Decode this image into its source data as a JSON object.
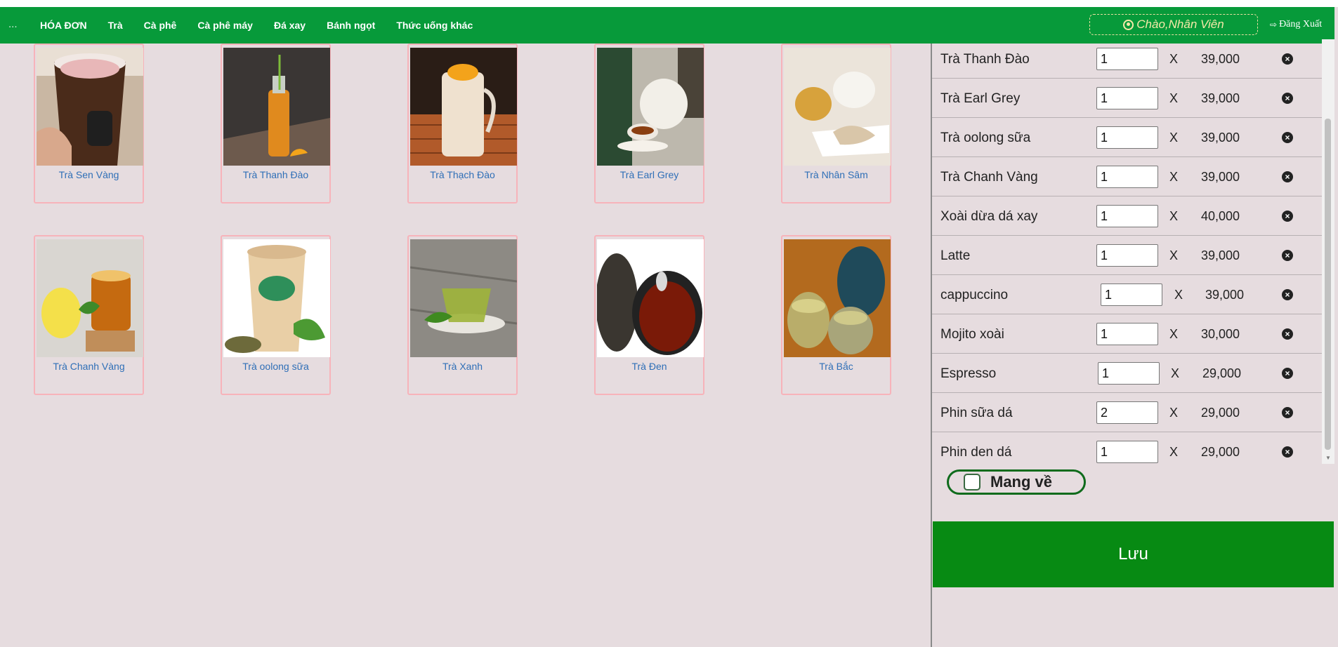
{
  "nav": {
    "dots": "...",
    "items": [
      "HÓA ĐƠN",
      "Trà",
      "Cà phê",
      "Cà phê máy",
      "Đá xay",
      "Bánh ngọt",
      "Thức uống khác"
    ],
    "greeting": "Chào,Nhân Viên",
    "logout": "Đăng Xuất"
  },
  "products": [
    {
      "name": "Trà Sen Vàng",
      "icon": "milk-tea-cup-photo"
    },
    {
      "name": "Trà Thanh Đào",
      "icon": "bottle-tea-photo"
    },
    {
      "name": "Trà Thạch Đào",
      "icon": "jar-tea-photo"
    },
    {
      "name": "Trà Earl Grey",
      "icon": "teapot-photo"
    },
    {
      "name": "Trà Nhân Sâm",
      "icon": "ginseng-tea-photo"
    },
    {
      "name": "Trà Chanh Vàng",
      "icon": "lemon-tea-photo"
    },
    {
      "name": "Trà oolong sữa",
      "icon": "oolong-milk-tea-photo"
    },
    {
      "name": "Trà Xanh",
      "icon": "green-tea-photo"
    },
    {
      "name": "Trà Đen",
      "icon": "black-tea-photo"
    },
    {
      "name": "Trà Bắc",
      "icon": "tea-cups-photo"
    }
  ],
  "order": [
    {
      "name": "Trà Thanh Đào",
      "qty": "1",
      "x": "X",
      "price": "39,000"
    },
    {
      "name": "Trà Earl Grey",
      "qty": "1",
      "x": "X",
      "price": "39,000"
    },
    {
      "name": "Trà oolong sữa",
      "qty": "1",
      "x": "X",
      "price": "39,000"
    },
    {
      "name": "Trà Chanh Vàng",
      "qty": "1",
      "x": "X",
      "price": "39,000"
    },
    {
      "name": "Xoài dừa dá xay",
      "qty": "1",
      "x": "X",
      "price": "40,000"
    },
    {
      "name": "Latte",
      "qty": "1",
      "x": "X",
      "price": "39,000"
    },
    {
      "name": "cappuccino",
      "qty": "1",
      "x": "X",
      "price": "39,000"
    },
    {
      "name": "Mojito xoài",
      "qty": "1",
      "x": "X",
      "price": "30,000"
    },
    {
      "name": "Espresso",
      "qty": "1",
      "x": "X",
      "price": "29,000"
    },
    {
      "name": "Phin sữa dá",
      "qty": "2",
      "x": "X",
      "price": "29,000"
    },
    {
      "name": "Phin den dá",
      "qty": "1",
      "x": "X",
      "price": "29,000"
    }
  ],
  "takeaway_label": "Mang về",
  "save_label": "Lưu",
  "colors": {
    "nav": "#079a3a",
    "save": "#078a13",
    "link": "#2f6fb7"
  }
}
